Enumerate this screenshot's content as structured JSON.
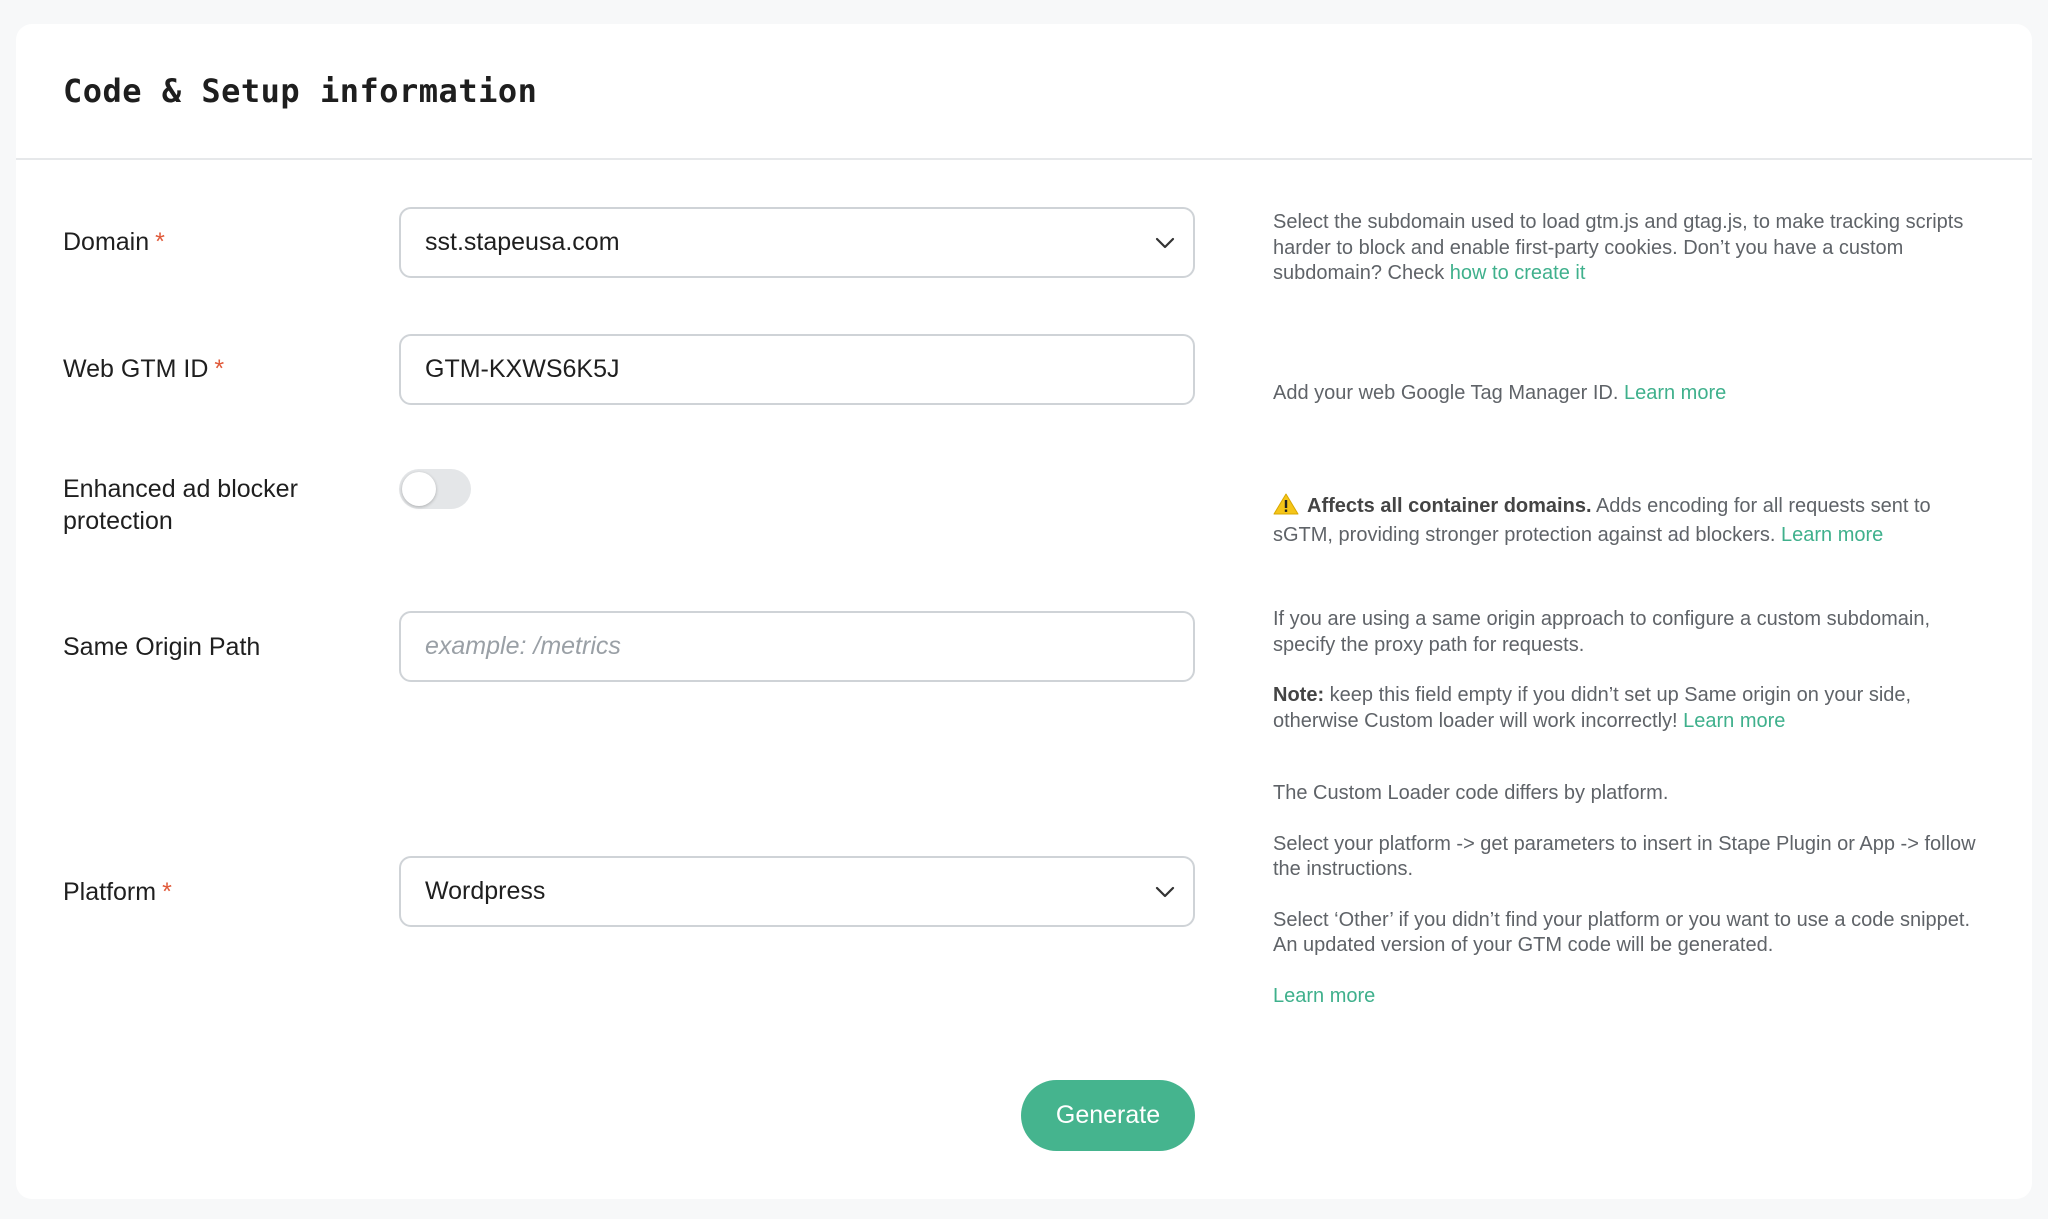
{
  "header": {
    "title": "Code & Setup information"
  },
  "domain": {
    "label": "Domain",
    "required_mark": "*",
    "value": "sst.stapeusa.com",
    "help_text": "Select the subdomain used to load gtm.js and gtag.js, to make tracking scripts harder to block and enable first-party cookies. Don’t you have a custom subdomain? Check ",
    "help_link": "how to create it"
  },
  "gtm": {
    "label": "Web GTM ID",
    "required_mark": "*",
    "value": "GTM-KXWS6K5J",
    "help_text": "Add your web Google Tag Manager ID. ",
    "help_link": "Learn more"
  },
  "adblock": {
    "label": "Enhanced ad blocker protection",
    "toggle_on": false,
    "help_bold": "Affects all container domains.",
    "help_text": " Adds encoding for all requests sent to sGTM, providing stronger protection against ad blockers. ",
    "help_link": "Learn more"
  },
  "origin": {
    "label": "Same Origin Path",
    "placeholder": "example: /metrics",
    "help_text_1": "If you are using a same origin approach to configure a custom subdomain, specify the proxy path for requests.",
    "note_label": "Note:",
    "note_text": " keep this field empty if you didn’t set up Same origin on your side, otherwise Custom loader will work incorrectly! ",
    "help_link": "Learn more"
  },
  "platform": {
    "label": "Platform",
    "required_mark": "*",
    "value": "Wordpress",
    "help_1": "The Custom Loader code differs by platform.",
    "help_2": "Select your platform -> get parameters to insert in Stape Plugin or App -> follow the instructions.",
    "help_3": "Select ‘Other’ if you didn’t find your platform or you want to use a code snippet. An updated version of your GTM code will be generated.",
    "help_link": "Learn more"
  },
  "actions": {
    "generate_label": "Generate"
  },
  "colors": {
    "accent": "#45b48e",
    "link": "#3fb08c",
    "required": "#e05a3a",
    "warning": "#f5c518"
  }
}
